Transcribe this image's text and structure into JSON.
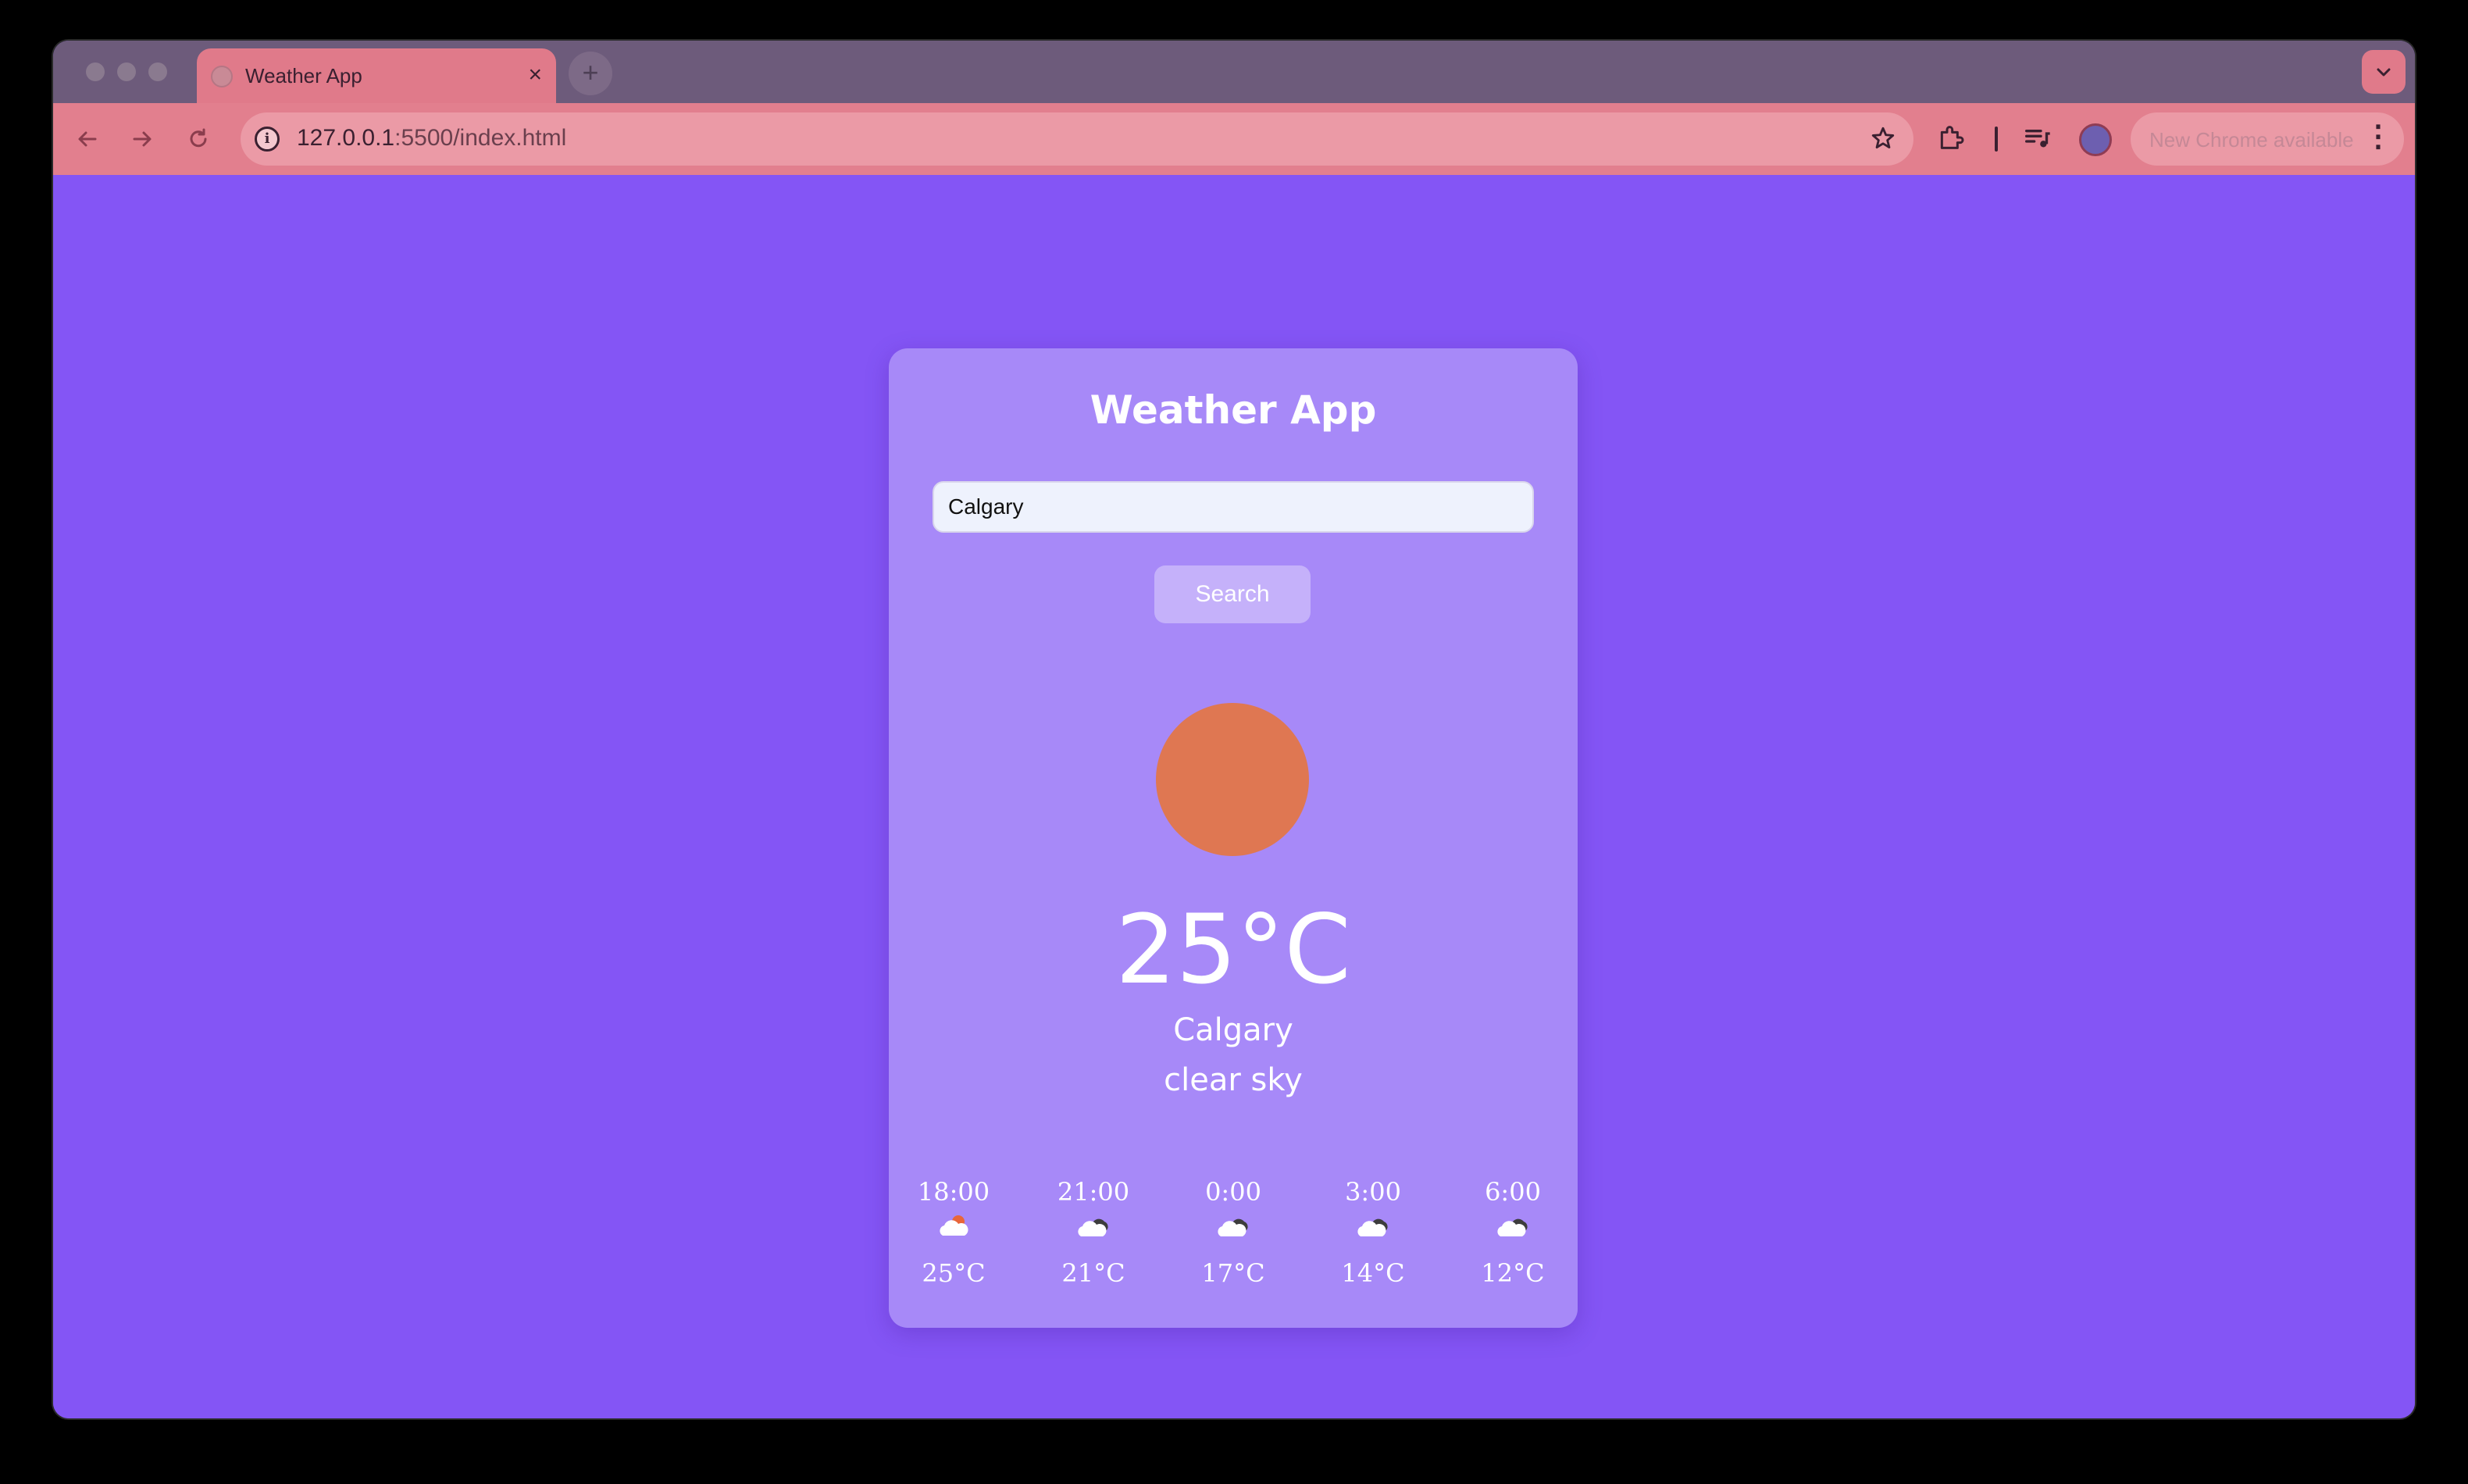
{
  "browser": {
    "tab_title": "Weather App",
    "tab_close": "×",
    "new_tab": "+",
    "url_host": "127.0.0.1",
    "url_rest": ":5500/index.html",
    "update_text": "New Chrome available",
    "tab_search_icon": "chevron-down-icon",
    "nav": {
      "back": "←",
      "forward": "→",
      "reload": "↻"
    }
  },
  "app": {
    "title": "Weather App",
    "search_value": "Calgary",
    "search_label": "Search",
    "temperature": "25°C",
    "city": "Calgary",
    "description": "clear sky",
    "main_icon": "sun",
    "forecast": [
      {
        "time": "18:00",
        "temp": "25°C",
        "icon": "partly-cloudy-day-icon"
      },
      {
        "time": "21:00",
        "temp": "21°C",
        "icon": "cloudy-night-icon"
      },
      {
        "time": "0:00",
        "temp": "17°C",
        "icon": "cloudy-night-icon"
      },
      {
        "time": "3:00",
        "temp": "14°C",
        "icon": "cloudy-night-icon"
      },
      {
        "time": "6:00",
        "temp": "12°C",
        "icon": "cloudy-night-icon"
      }
    ]
  },
  "colors": {
    "page_bg": "#8455f5",
    "card_bg": "#a789f8",
    "sun": "#df7752",
    "button_bg": "#c5b1fa",
    "tab_bg": "#e07a8a"
  }
}
